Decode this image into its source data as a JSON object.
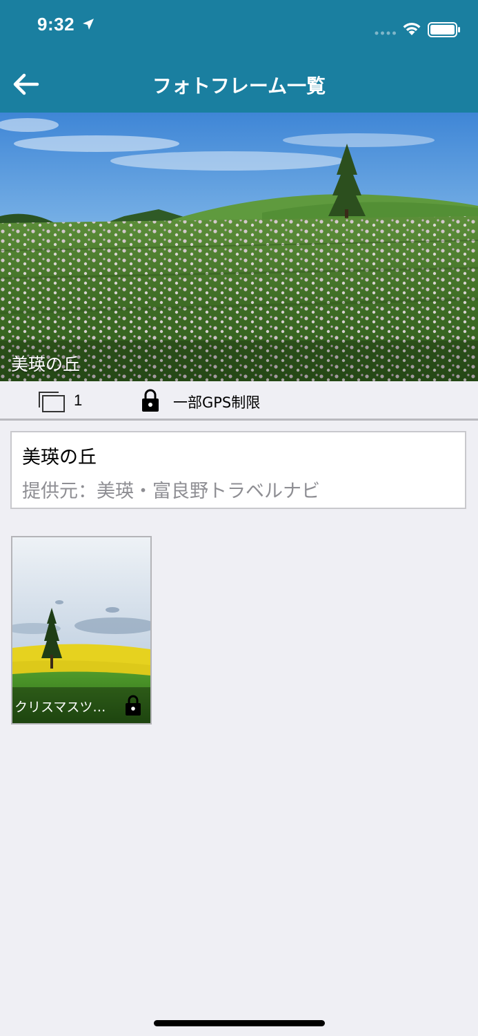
{
  "status_bar": {
    "time": "9:32"
  },
  "navbar": {
    "title": "フォトフレーム一覧"
  },
  "hero": {
    "title": "美瑛の丘"
  },
  "info_bar": {
    "frame_count": "1",
    "restriction": "一部GPS制限"
  },
  "card": {
    "title": "美瑛の丘",
    "provider": "提供元：美瑛・富良野トラベルナビ"
  },
  "frames": [
    {
      "label": "クリスマスツ…",
      "locked": true
    }
  ],
  "colors": {
    "primary": "#1a7fa0",
    "background": "#efeff4"
  }
}
